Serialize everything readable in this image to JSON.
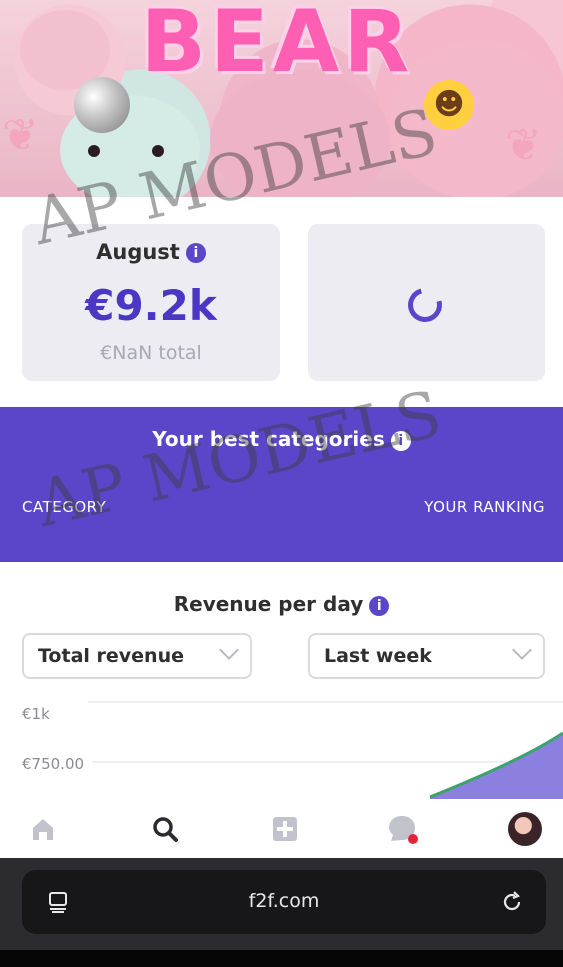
{
  "banner": {
    "title": "BEAR"
  },
  "stats": {
    "month_label": "August",
    "month_info_icon": "info-icon",
    "amount": "€9.2k",
    "total": "€NaN total",
    "loading_icon": "spinner-icon"
  },
  "best_categories": {
    "title": "Your best categories",
    "info_icon": "info-icon",
    "col_category": "CATEGORY",
    "col_ranking": "YOUR RANKING"
  },
  "revenue": {
    "title": "Revenue per day",
    "info_icon": "info-icon",
    "metric_select": "Total revenue",
    "period_select": "Last week"
  },
  "chart_data": {
    "type": "area",
    "y_tick_labels": [
      "€1k",
      "€750.00"
    ],
    "ylim": [
      750,
      1000
    ],
    "series_color": "#8b7fe0",
    "line_color": "#3aa36b"
  },
  "tabbar": {
    "items": [
      "home-icon",
      "search-icon",
      "plus-square-icon",
      "chat-icon",
      "avatar"
    ]
  },
  "browser": {
    "url": "f2f.com",
    "left_icon": "tabs-icon",
    "right_icon": "reload-icon"
  },
  "watermark": {
    "text": "AP MODELS"
  },
  "colors": {
    "accent": "#5b45c8",
    "pink": "#ff5fb3",
    "card": "#ececf2"
  }
}
